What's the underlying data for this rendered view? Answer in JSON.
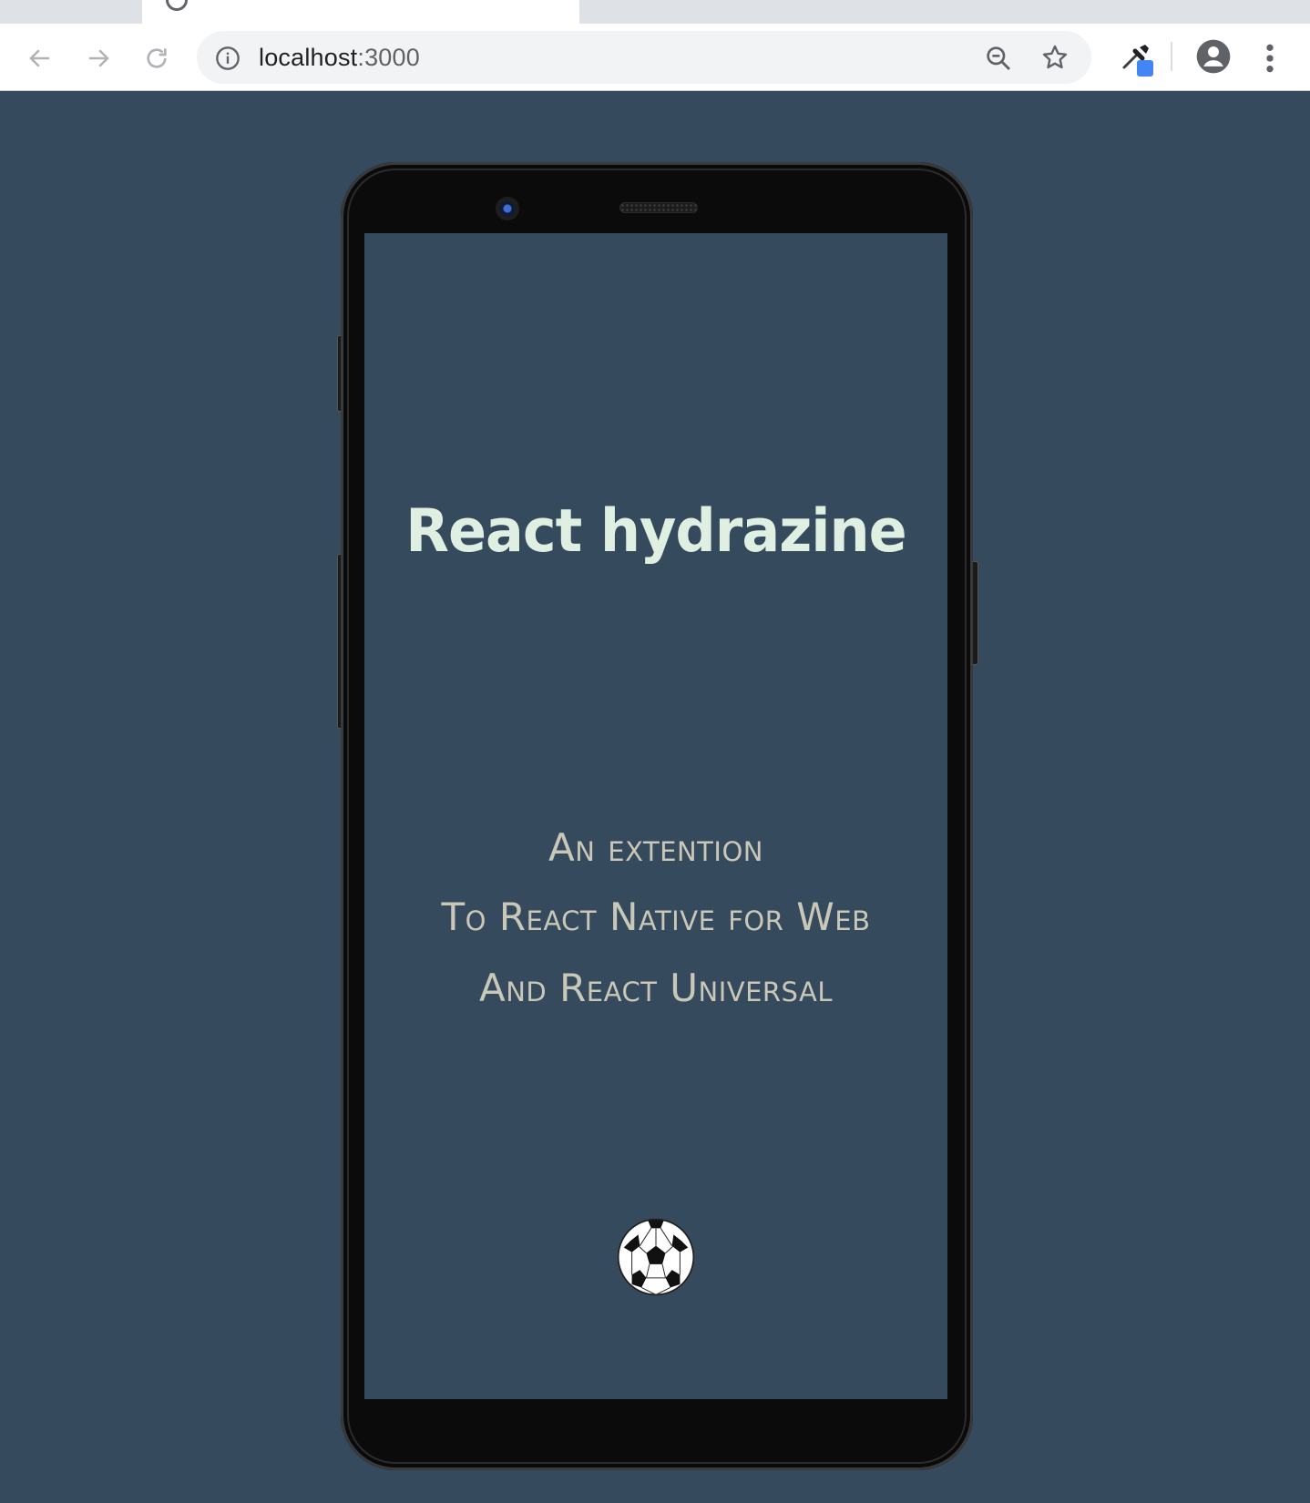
{
  "browser": {
    "address": {
      "host": "localhost",
      "port": ":3000"
    },
    "icons": {
      "back": "arrow-left-icon",
      "forward": "arrow-right-icon",
      "reload": "reload-icon",
      "info": "info-icon",
      "zoom": "zoom-out-icon",
      "bookmark": "star-icon",
      "extension": "eyedropper-icon",
      "profile": "account-icon",
      "menu": "kebab-menu-icon"
    }
  },
  "app": {
    "title": "React hydrazine",
    "tagline": [
      "An extention",
      "To React Native for Web",
      "And React Universal"
    ],
    "icon": "soccer-ball-icon",
    "colors": {
      "background": "#364a5e",
      "title": "#dff0e2",
      "tagline": "#c9c7b8"
    }
  }
}
